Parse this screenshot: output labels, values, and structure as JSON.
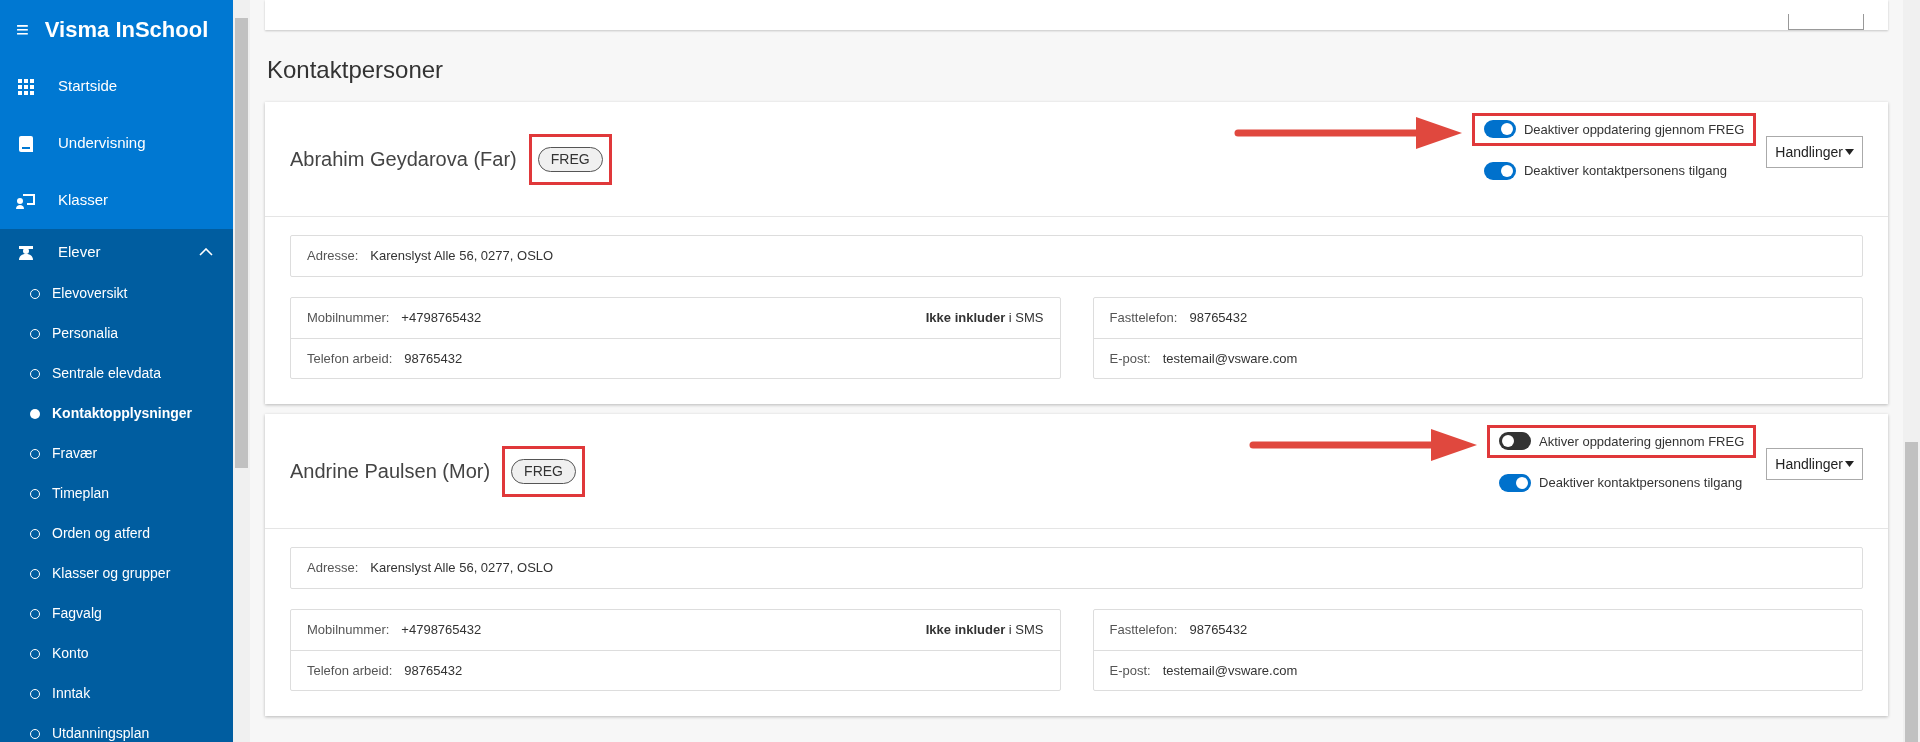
{
  "app": {
    "menu_icon": "≡",
    "title": "Visma InSchool"
  },
  "nav": [
    {
      "kind": "grid",
      "label": "Startside"
    },
    {
      "kind": "book",
      "label": "Undervisning"
    },
    {
      "kind": "board",
      "label": "Klasser"
    },
    {
      "kind": "student",
      "label": "Elever",
      "expanded": true,
      "children": [
        {
          "label": "Elevoversikt",
          "selected": false
        },
        {
          "label": "Personalia",
          "selected": false
        },
        {
          "label": "Sentrale elevdata",
          "selected": false
        },
        {
          "label": "Kontaktopplysninger",
          "selected": true
        },
        {
          "label": "Fravær",
          "selected": false
        },
        {
          "label": "Timeplan",
          "selected": false
        },
        {
          "label": "Orden og atferd",
          "selected": false
        },
        {
          "label": "Klasser og grupper",
          "selected": false
        },
        {
          "label": "Fagvalg",
          "selected": false
        },
        {
          "label": "Konto",
          "selected": false
        },
        {
          "label": "Inntak",
          "selected": false
        },
        {
          "label": "Utdanningsplan",
          "selected": false
        }
      ]
    }
  ],
  "section_title": "Kontaktpersoner",
  "contacts": [
    {
      "name": "Abrahim Geydarova (Far)",
      "badge": {
        "label": "FREG",
        "highlighted": true
      },
      "toggles": [
        {
          "label": "Deaktiver oppdatering gjennom FREG",
          "on": true,
          "highlighted": true
        },
        {
          "label": "Deaktiver kontaktpersonens tilgang",
          "on": true,
          "highlighted": false
        }
      ],
      "actions": "Handlinger",
      "address": {
        "label": "Adresse:",
        "value": "Karenslyst Alle 56, 0277, OSLO"
      },
      "left": [
        {
          "label": "Mobilnummer:",
          "value": "+4798765432",
          "note": "**Ikke inkluder** i SMS"
        },
        {
          "label": "Telefon arbeid:",
          "value": "98765432"
        }
      ],
      "right": [
        {
          "label": "Fasttelefon:",
          "value": "98765432"
        },
        {
          "label": "E-post:",
          "value": "testemail@vsware.com"
        }
      ]
    },
    {
      "name": "Andrine Paulsen (Mor)",
      "badge": {
        "label": "FREG",
        "highlighted": true
      },
      "toggles": [
        {
          "label": "Aktiver oppdatering gjennom FREG",
          "on": false,
          "highlighted": true
        },
        {
          "label": "Deaktiver kontaktpersonens tilgang",
          "on": true,
          "highlighted": false
        }
      ],
      "actions": "Handlinger",
      "address": {
        "label": "Adresse:",
        "value": "Karenslyst Alle 56, 0277, OSLO"
      },
      "left": [
        {
          "label": "Mobilnummer:",
          "value": "+4798765432",
          "note": "**Ikke inkluder** i SMS"
        },
        {
          "label": "Telefon arbeid:",
          "value": "98765432"
        }
      ],
      "right": [
        {
          "label": "Fasttelefon:",
          "value": "98765432"
        },
        {
          "label": "E-post:",
          "value": "testemail@vsware.com"
        }
      ]
    }
  ]
}
